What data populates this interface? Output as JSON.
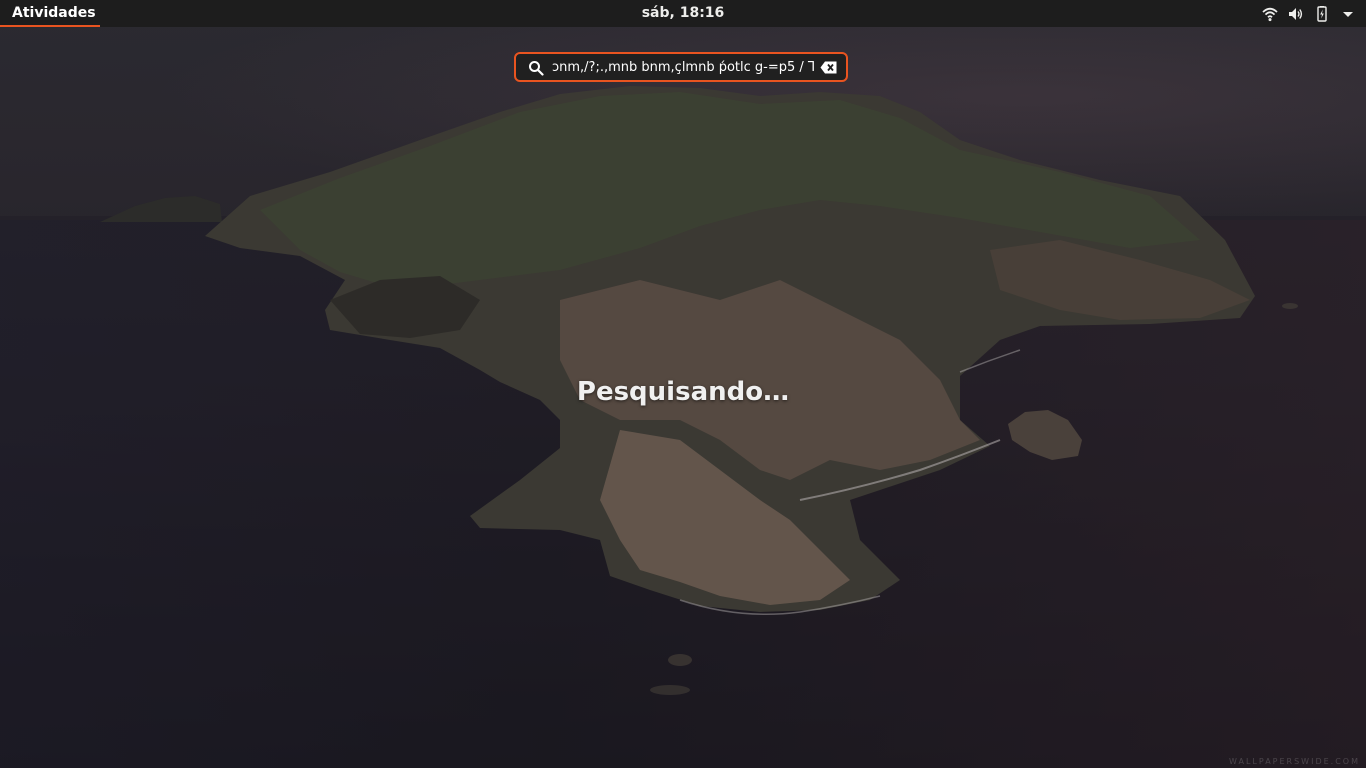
{
  "top_bar": {
    "activities_label": "Atividades",
    "clock": "sáb, 18:16",
    "status_icons": [
      "wifi-icon",
      "volume-icon",
      "battery-charging-icon",
      "menu-arrow-icon"
    ]
  },
  "search": {
    "value": "ɔnm,/?;.,mnb bnm,çlmnb  ṕotlc g-=p5 / Ꞁ",
    "search_icon": "search-icon",
    "clear_icon": "clear-backspace-icon"
  },
  "status_message": "Pesquisando…",
  "wallpaper": {
    "watermark": "WALLPAPERSWIDE.COM"
  },
  "colors": {
    "accent": "#e95420",
    "panel": "#1d1d1d"
  }
}
